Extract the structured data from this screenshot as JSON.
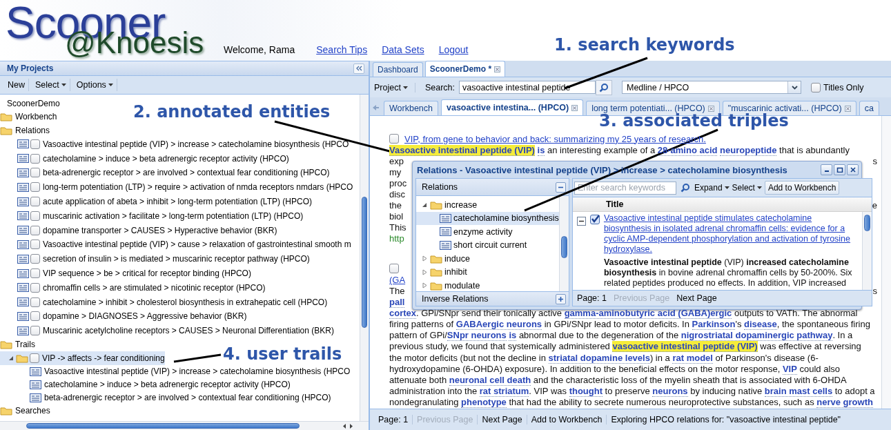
{
  "header": {
    "logo_title": "Scooner",
    "logo_subtitle": "@Knoesis",
    "welcome": "Welcome, Rama",
    "links": [
      "Search Tips",
      "Data Sets",
      "Logout"
    ]
  },
  "projects": {
    "title": "My Projects",
    "toolbar": [
      {
        "label": "New",
        "kind": "button"
      },
      {
        "label": "Select",
        "kind": "menu"
      },
      {
        "label": "Options",
        "kind": "menu"
      }
    ],
    "tree": [
      {
        "label": "ScoonerDemo",
        "kind": "root",
        "selected": false,
        "children": [
          {
            "label": "Workbench",
            "kind": "folder",
            "selected": false
          },
          {
            "label": "Relations",
            "kind": "folder",
            "selected": false,
            "children": [
              {
                "label": "Vasoactive intestinal peptide (VIP) > increase > catecholamine biosynthesis (HPCO",
                "kind": "relation",
                "checked": false,
                "selected": false
              },
              {
                "label": "catecholamine > induce > beta adrenergic receptor activity (HPCO)",
                "kind": "relation",
                "checked": false,
                "selected": false
              },
              {
                "label": "beta-adrenergic receptor > are involved > contextual fear conditioning (HPCO)",
                "kind": "relation",
                "checked": false,
                "selected": false
              },
              {
                "label": "long-term potentiation (LTP) > require > activation of nmda receptors nmdars (HPCO",
                "kind": "relation",
                "checked": false,
                "selected": false
              },
              {
                "label": "acute application of abeta > inhibit > long-term potentiation (LTP) (HPCO)",
                "kind": "relation",
                "checked": false,
                "selected": false
              },
              {
                "label": "muscarinic activation > facilitate > long-term potentiation (LTP) (HPCO)",
                "kind": "relation",
                "checked": false,
                "selected": false
              },
              {
                "label": "dopamine transporter > CAUSES > Hyperactive behavior (BKR)",
                "kind": "relation",
                "checked": false,
                "selected": false
              },
              {
                "label": "Vasoactive intestinal peptide (VIP) > cause > relaxation of gastrointestinal smooth m",
                "kind": "relation",
                "checked": false,
                "selected": false
              },
              {
                "label": "secretion of insulin > is mediated > muscarinic receptor pathway (HPCO)",
                "kind": "relation",
                "checked": false,
                "selected": false
              },
              {
                "label": "VIP sequence > be > critical for receptor binding (HPCO)",
                "kind": "relation",
                "checked": false,
                "selected": false
              },
              {
                "label": "chromaffin cells > are stimulated > nicotinic receptor (HPCO)",
                "kind": "relation",
                "checked": false,
                "selected": false
              },
              {
                "label": "catecholamine > inhibit > cholesterol biosynthesis in extrahepatic cell (HPCO)",
                "kind": "relation",
                "checked": false,
                "selected": false
              },
              {
                "label": "dopamine > DIAGNOSES > Aggressive behavior (BKR)",
                "kind": "relation",
                "checked": false,
                "selected": false
              },
              {
                "label": "Muscarinic acetylcholine receptors > CAUSES > Neuronal Differentiation (BKR)",
                "kind": "relation",
                "checked": false,
                "selected": false
              }
            ]
          },
          {
            "label": "Trails",
            "kind": "folder",
            "selected": false,
            "children": [
              {
                "label": "VIP -> affects -> fear conditioning",
                "kind": "trail",
                "expanded": true,
                "checked": false,
                "selected": true,
                "children": [
                  {
                    "label": "Vasoactive intestinal peptide (VIP) > increase > catecholamine biosynthesis (HPCO",
                    "kind": "step",
                    "selected": false
                  },
                  {
                    "label": "catecholamine > induce > beta adrenergic receptor activity (HPCO)",
                    "kind": "step",
                    "selected": false
                  },
                  {
                    "label": "beta-adrenergic receptor > are involved > contextual fear conditioning (HPCO)",
                    "kind": "step",
                    "selected": false
                  }
                ]
              }
            ]
          },
          {
            "label": "Searches",
            "kind": "folder",
            "selected": false
          }
        ]
      }
    ]
  },
  "main": {
    "tabs": [
      {
        "label": "Dashboard",
        "selected": false,
        "closable": false
      },
      {
        "label": "ScoonerDemo *",
        "selected": true,
        "closable": true
      }
    ],
    "toolbar": {
      "project_menu": "Project",
      "search_label": "Search:",
      "search_value": "vasoactive intestinal peptide",
      "source": "Medline / HPCO",
      "titles_only": {
        "label": "Titles Only",
        "checked": false
      }
    },
    "result_tabs": [
      {
        "label": "Workbench",
        "selected": false,
        "closable": false
      },
      {
        "label": "vasoactive intestina... (HPCO)",
        "selected": true,
        "closable": true
      },
      {
        "label": "long term potentiati... (HPCO)",
        "selected": false,
        "closable": true
      },
      {
        "label": "\"muscarinic activati... (HPCO)",
        "selected": false,
        "closable": true
      },
      {
        "label": "ca",
        "selected": false,
        "closable": false
      }
    ],
    "results": [
      {
        "checked": false,
        "title": "VIP, from gene to behavior and back: summarizing my 25 years of research.",
        "lines": [
          {
            "segments": [
              {
                "text": "Vasoactive intestinal peptide (VIP)",
                "kind": "highlight"
              },
              {
                "text": "is",
                "kind": "entity"
              },
              {
                "text": " an interesting example of a ",
                "kind": "plain"
              },
              {
                "text": "28-amino acid",
                "kind": "entity"
              },
              {
                "text": "neuropeptide",
                "kind": "entity"
              },
              {
                "text": " that is abundantly",
                "kind": "plain"
              }
            ]
          },
          {
            "segments": [
              {
                "text": "exp",
                "kind": "plain"
              }
            ],
            "end": "s"
          },
          {
            "segments": [
              {
                "text": "my",
                "kind": "plain"
              }
            ]
          },
          {
            "segments": [
              {
                "text": "proc",
                "kind": "plain"
              }
            ]
          },
          {
            "segments": [
              {
                "text": "disc",
                "kind": "plain"
              }
            ]
          },
          {
            "segments": [
              {
                "text": "the",
                "kind": "plain"
              }
            ],
            "end": "e"
          },
          {
            "segments": [
              {
                "text": "biol",
                "kind": "plain"
              }
            ]
          },
          {
            "segments": [
              {
                "text": "This",
                "kind": "plain"
              }
            ]
          },
          {
            "segments": [
              {
                "text": "http",
                "kind": "url"
              }
            ]
          }
        ]
      },
      {
        "checked": false,
        "title_continuation": "(GA",
        "lines": [
          {
            "segments": [
              {
                "text": "The",
                "kind": "plain"
              }
            ],
            "end": "s"
          },
          {
            "segments": [
              {
                "text": "pall",
                "kind": "entity"
              }
            ]
          },
          {
            "segments": [
              {
                "text": "cortex",
                "kind": "entity"
              },
              {
                "text": ". GPi/SNpr send their tonically active ",
                "kind": "plain"
              },
              {
                "text": "gamma-aminobutyric acid (GABA)ergic",
                "kind": "entity"
              },
              {
                "text": " outputs to VATh. The abnormal",
                "kind": "plain"
              }
            ]
          },
          {
            "segments": [
              {
                "text": "firing patterns of ",
                "kind": "plain"
              },
              {
                "text": "GABAergic neurons",
                "kind": "entity"
              },
              {
                "text": " in GPi/SNpr lead to motor deficits. In ",
                "kind": "plain"
              },
              {
                "text": "Parkinson",
                "kind": "entity"
              },
              {
                "text": "'s ",
                "kind": "plain"
              },
              {
                "text": "disease",
                "kind": "entity"
              },
              {
                "text": ", the spontaneous firing",
                "kind": "plain"
              }
            ]
          },
          {
            "segments": [
              {
                "text": "pattern of GPi/",
                "kind": "plain"
              },
              {
                "text": "SNpr neurons",
                "kind": "entity"
              },
              {
                "text": "is",
                "kind": "entity"
              },
              {
                "text": " abnormal due to the degeneration of the ",
                "kind": "plain"
              },
              {
                "text": "nigrostriatal dopaminergic pathway",
                "kind": "entity"
              },
              {
                "text": ". In a",
                "kind": "plain"
              }
            ]
          },
          {
            "segments": [
              {
                "text": "previous study, we found that systemically administered ",
                "kind": "plain"
              },
              {
                "text": "vasoactive intestinal peptide (VIP)",
                "kind": "highlight"
              },
              {
                "text": " was effective at reversing",
                "kind": "plain"
              }
            ]
          },
          {
            "segments": [
              {
                "text": "the motor deficits (but not the decline in ",
                "kind": "plain"
              },
              {
                "text": "striatal dopamine levels",
                "kind": "entity"
              },
              {
                "text": ") in a ",
                "kind": "plain"
              },
              {
                "text": "rat model",
                "kind": "entity"
              },
              {
                "text": " of Parkinson's disease (6-",
                "kind": "plain"
              }
            ]
          },
          {
            "segments": [
              {
                "text": "hydroxydopamine (6-OHDA) exposure). In addition to the beneficial effects on the motor response, ",
                "kind": "plain"
              },
              {
                "text": "VIP",
                "kind": "entity"
              },
              {
                "text": " could also",
                "kind": "plain"
              }
            ]
          },
          {
            "segments": [
              {
                "text": "attenuate both ",
                "kind": "plain"
              },
              {
                "text": "neuronal cell death",
                "kind": "entity"
              },
              {
                "text": " and the characteristic loss of the myelin sheath that is associated with 6-OHDA",
                "kind": "plain"
              }
            ]
          },
          {
            "segments": [
              {
                "text": "administration into the ",
                "kind": "plain"
              },
              {
                "text": "rat striatum",
                "kind": "entity"
              },
              {
                "text": ". VIP was ",
                "kind": "plain"
              },
              {
                "text": "thought",
                "kind": "entity"
              },
              {
                "text": " to preserve ",
                "kind": "plain"
              },
              {
                "text": "neurons",
                "kind": "entity"
              },
              {
                "text": " by inducing native ",
                "kind": "plain"
              },
              {
                "text": "brain mast cells",
                "kind": "entity"
              },
              {
                "text": " to adopt a",
                "kind": "plain"
              }
            ]
          },
          {
            "segments": [
              {
                "text": "nondegranulating ",
                "kind": "plain"
              },
              {
                "text": "phenotype",
                "kind": "entity"
              },
              {
                "text": " that had the ability to secrete numerous neuroprotective substances, such as ",
                "kind": "plain"
              },
              {
                "text": "nerve growth",
                "kind": "entity"
              }
            ]
          }
        ]
      }
    ],
    "status_bar": {
      "page": "Page: 1",
      "prev": {
        "label": "Previous Page",
        "disabled": true
      },
      "next": {
        "label": "Next Page",
        "disabled": false
      },
      "add": "Add to Workbench",
      "message": "Exploring HPCO relations for: \"vasoactive intestinal peptide\""
    }
  },
  "popup": {
    "title": "Relations - Vasoactive intestinal peptide (VIP) > increase > catecholamine biosynthesis",
    "left": {
      "title": "Relations",
      "tree": [
        {
          "label": "increase",
          "kind": "folder",
          "expanded": true,
          "selected": false,
          "children": [
            {
              "label": "catecholamine biosynthesis",
              "kind": "relation",
              "selected": true
            },
            {
              "label": "enzyme activity",
              "kind": "relation",
              "selected": false
            },
            {
              "label": "short circuit current",
              "kind": "relation",
              "selected": false
            }
          ]
        },
        {
          "label": "induce",
          "kind": "folder",
          "expanded": false,
          "selected": false
        },
        {
          "label": "inhibit",
          "kind": "folder",
          "expanded": false,
          "selected": false
        },
        {
          "label": "modulate",
          "kind": "folder",
          "expanded": false,
          "selected": false
        }
      ],
      "footer": "Inverse Relations"
    },
    "right": {
      "search_placeholder": "Enter search keywords",
      "menus": [
        "Expand",
        "Select"
      ],
      "add_button": "Add to Workbench",
      "column": "Title",
      "rows": [
        {
          "expanded": true,
          "checked": true,
          "title": "Vasoactive intestinal peptide stimulates catecholamine biosynthesis in isolated adrenal chromaffin cells: evidence for a cyclic AMP-dependent phosphorylation and activation of tyrosine hydroxylase.",
          "snippet": "**Vasoactive intestinal peptide** (VIP) **increased catecholamine biosynthesis** in bovine adrenal chromaffin cells by 50-200%. Six related peptides produced no effects. In addition, VIP increased"
        }
      ],
      "pager": {
        "page": "Page: 1",
        "prev": {
          "label": "Previous Page",
          "disabled": true
        },
        "next": {
          "label": "Next Page",
          "disabled": false
        }
      }
    }
  },
  "annotations": [
    {
      "label": "1. search keywords"
    },
    {
      "label": "2. annotated entities"
    },
    {
      "label": "3. associated triples"
    },
    {
      "label": "4. user trails"
    }
  ]
}
